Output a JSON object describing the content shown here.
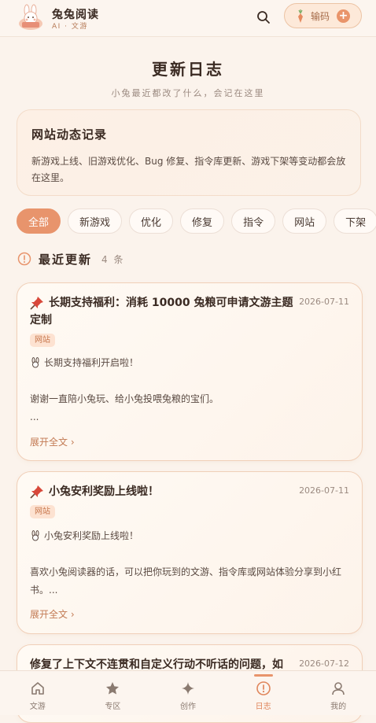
{
  "header": {
    "app_name": "兔兔阅读",
    "app_sub": "AI · 文游",
    "code_button_label": "输码",
    "plus_label": "+"
  },
  "page": {
    "title": "更新日志",
    "subtitle": "小兔最近都改了什么，会记在这里"
  },
  "info_card": {
    "title": "网站动态记录",
    "desc": "新游戏上线、旧游戏优化、Bug 修复、指令库更新、游戏下架等变动都会放在这里。"
  },
  "filters": [
    "全部",
    "新游戏",
    "优化",
    "修复",
    "指令",
    "网站",
    "下架"
  ],
  "section": {
    "title": "最近更新",
    "count": "4 条"
  },
  "cards": [
    {
      "title": "长期支持福利：消耗 10000 兔粮可申请文游主题定制",
      "date": "2026-07-11",
      "tag": "网站",
      "line1": "长期支持福利开启啦！",
      "line2": "谢谢一直陪小兔玩、给小兔投喂兔粮的宝们。",
      "line3": "...",
      "more": "展开全文 ›"
    },
    {
      "title": "小兔安利奖励上线啦！",
      "date": "2026-07-11",
      "tag": "网站",
      "line1": "小兔安利奖励上线啦！",
      "line2": "喜欢小兔阅读器的话，可以把你玩到的文游、指令库或网站体验分享到小红书。...",
      "more": "展开全文 ›"
    },
    {
      "title": "修复了上下文不连贯和自定义行动不听话的问题，如",
      "date": "2026-07-12"
    }
  ],
  "nav": [
    {
      "label": "文游",
      "icon": "home-icon"
    },
    {
      "label": "专区",
      "icon": "star-icon"
    },
    {
      "label": "创作",
      "icon": "sparkle-icon"
    },
    {
      "label": "日志",
      "icon": "info-icon"
    },
    {
      "label": "我的",
      "icon": "user-icon"
    }
  ],
  "colors": {
    "accent": "#e8946c",
    "background": "#fbf3ec",
    "tag_bg": "#fde2d1",
    "tag_text": "#c8784e"
  }
}
